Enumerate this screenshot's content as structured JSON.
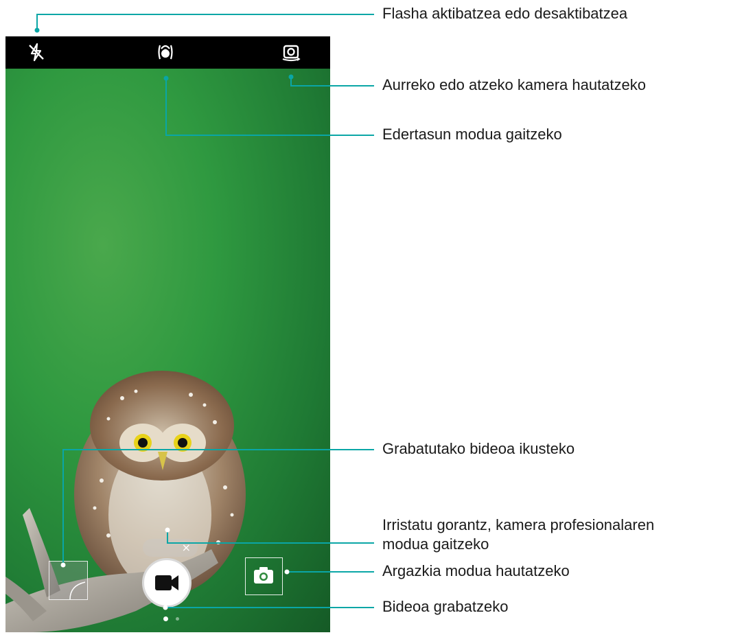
{
  "camera": {
    "mode": "video",
    "top_bar": {
      "flash_icon": "flash-off-icon",
      "beauty_icon": "beauty-mode-icon",
      "switch_icon": "switch-camera-icon"
    },
    "bottom_bar": {
      "gallery": "video-thumbnail",
      "shutter_icon": "video-camera-icon",
      "photo_icon": "camera-icon",
      "page_dots": 2,
      "active_dot": 1
    },
    "pro_mode_handle_icon": "close-icon"
  },
  "callouts": {
    "flash": "Flasha aktibatzea edo desaktibatzea",
    "switch_camera": "Aurreko edo atzeko kamera hautatzeko",
    "beauty": "Edertasun modua gaitzeko",
    "gallery": "Grabatutako bideoa ikusteko",
    "pro_mode_line1": "Irristatu gorantz, kamera profesionalaren",
    "pro_mode_line2": "modua gaitzeko",
    "photo_mode": "Argazkia modua hautatzeko",
    "record": "Bideoa grabatzeko"
  },
  "colors": {
    "callout_line": "#0aa6a6",
    "top_bar": "#000000",
    "background_green": "#2f9940"
  }
}
